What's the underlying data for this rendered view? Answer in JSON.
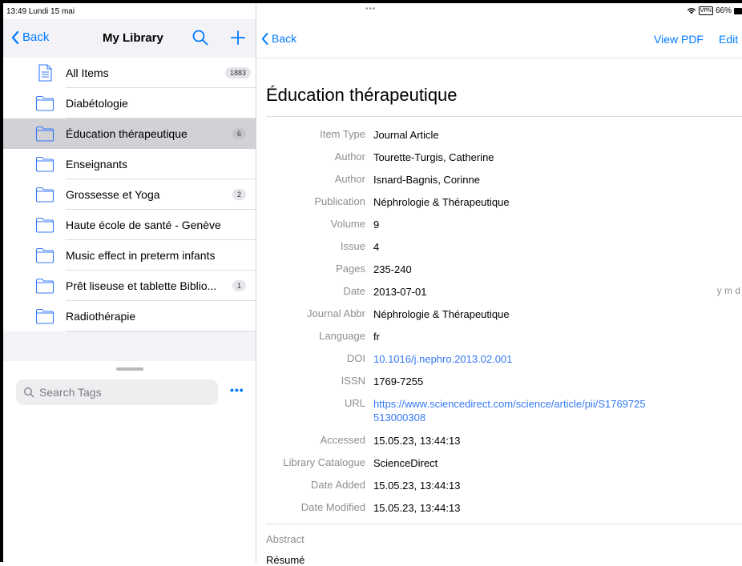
{
  "status": {
    "time_date": "13:49  Lundi 15 mai",
    "dots": "•••",
    "vpn": "VPN",
    "battery": "66%"
  },
  "sidebar": {
    "back_label": "Back",
    "title": "My Library",
    "collections": [
      {
        "label": "All Items",
        "badge": "1883",
        "icon": "document-icon"
      },
      {
        "label": "Diabétologie",
        "badge": "",
        "icon": "folder-icon"
      },
      {
        "label": "Éducation thérapeutique",
        "badge": "6",
        "icon": "folder-icon",
        "selected": true
      },
      {
        "label": "Enseignants",
        "badge": "",
        "icon": "folder-icon"
      },
      {
        "label": "Grossesse et Yoga",
        "badge": "2",
        "icon": "folder-icon"
      },
      {
        "label": "Haute école de santé - Genève",
        "badge": "",
        "icon": "folder-icon"
      },
      {
        "label": "Music effect in preterm infants",
        "badge": "",
        "icon": "folder-icon"
      },
      {
        "label": "Prêt liseuse et tablette Biblio...",
        "badge": "1",
        "icon": "folder-icon"
      },
      {
        "label": "Radiothérapie",
        "badge": "",
        "icon": "folder-icon"
      }
    ],
    "tag_search_placeholder": "Search Tags",
    "more_label": "•••"
  },
  "detail": {
    "back_label": "Back",
    "view_pdf_label": "View PDF",
    "edit_label": "Edit",
    "title": "Éducation thérapeutique",
    "fields": [
      {
        "label": "Item Type",
        "value": "Journal Article"
      },
      {
        "label": "Author",
        "value": "Tourette-Turgis, Catherine"
      },
      {
        "label": "Author",
        "value": "Isnard-Bagnis, Corinne"
      },
      {
        "label": "Publication",
        "value": "Néphrologie & Thérapeutique"
      },
      {
        "label": "Volume",
        "value": "9"
      },
      {
        "label": "Issue",
        "value": "4"
      },
      {
        "label": "Pages",
        "value": "235-240"
      },
      {
        "label": "Date",
        "value": "2013-07-01",
        "extra": "y m d"
      },
      {
        "label": "Journal Abbr",
        "value": "Néphrologie & Thérapeutique"
      },
      {
        "label": "Language",
        "value": "fr"
      },
      {
        "label": "DOI",
        "value": "10.1016/j.nephro.2013.02.001",
        "link": true
      },
      {
        "label": "ISSN",
        "value": "1769-7255"
      },
      {
        "label": "URL",
        "value": "https://www.sciencedirect.com/science/article/pii/S1769725513000308",
        "link": true,
        "tall": true
      },
      {
        "label": "Accessed",
        "value": "15.05.23, 13:44:13"
      },
      {
        "label": "Library Catalogue",
        "value": "ScienceDirect"
      },
      {
        "label": "Date Added",
        "value": "15.05.23, 13:44:13"
      },
      {
        "label": "Date Modified",
        "value": "15.05.23, 13:44:13"
      }
    ],
    "abstract_label": "Abstract",
    "abstract_value": "Résumé"
  },
  "colors": {
    "accent": "#007aff",
    "link": "#3478f6",
    "selected_row": "#d1d1d6",
    "sidebar_bg": "#f2f2f7",
    "secondary_text": "#8e8e93"
  }
}
